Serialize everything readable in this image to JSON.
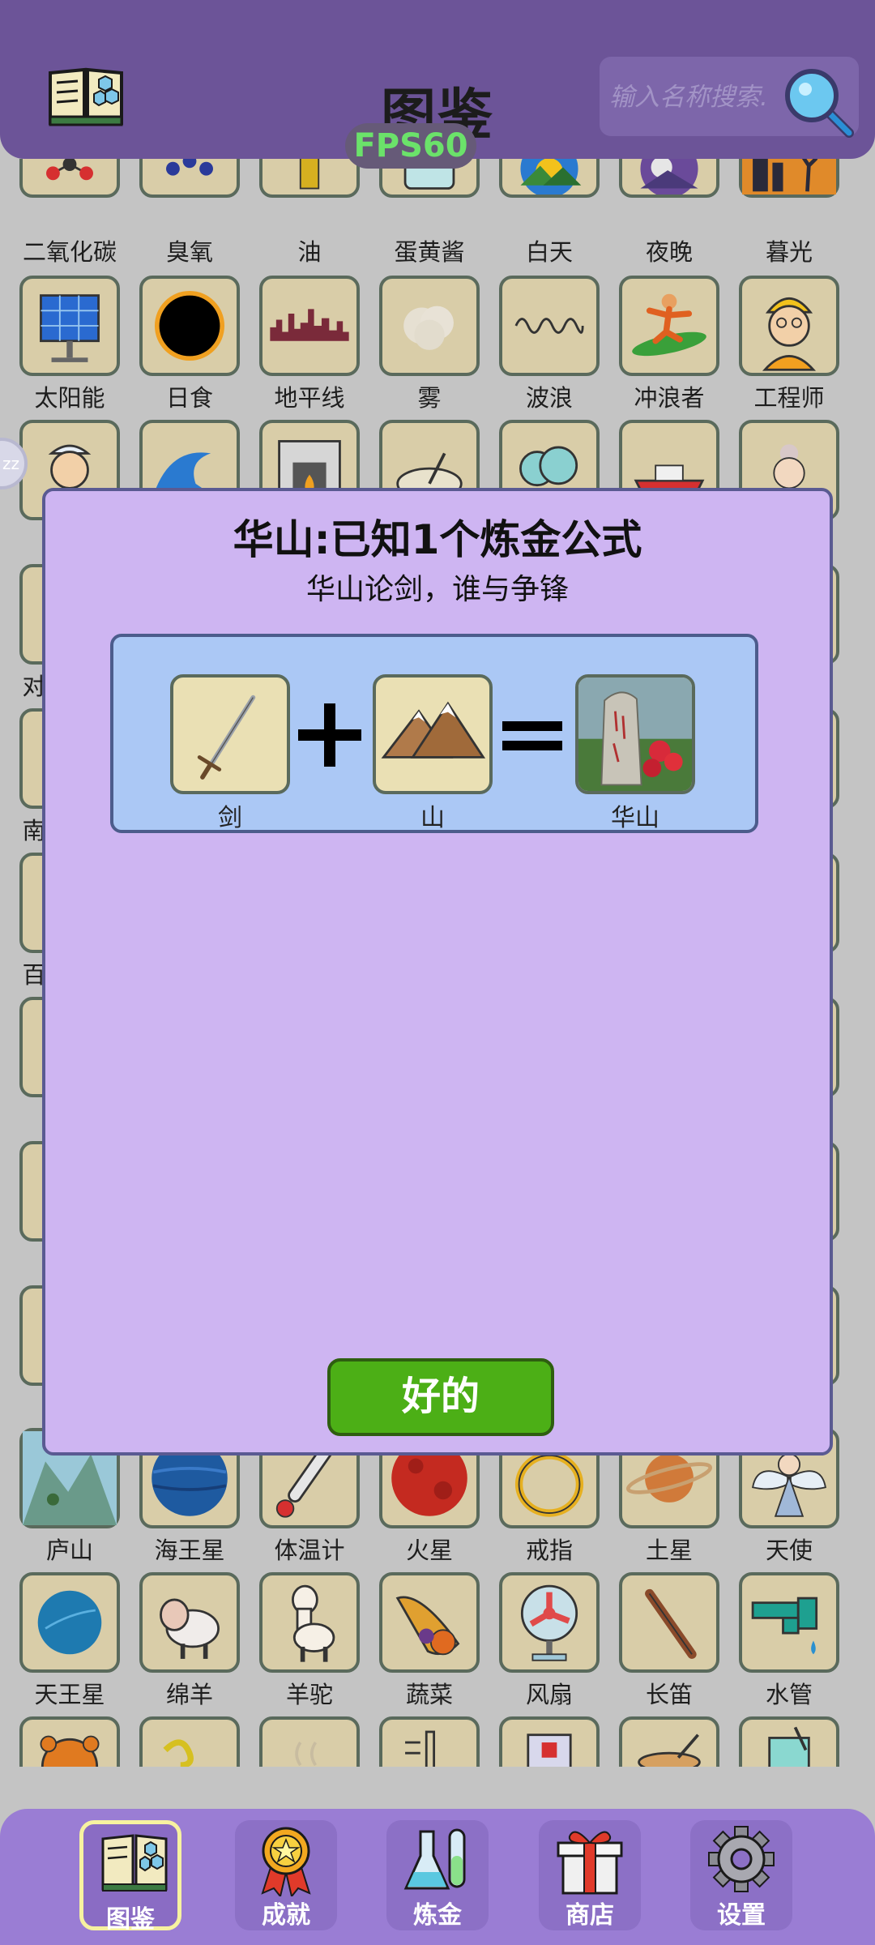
{
  "header": {
    "title": "图鉴",
    "fps": "FPS60",
    "search_placeholder": "输入名称搜索.",
    "side_badge": "zz"
  },
  "grid": {
    "row1": [
      "二氧化碳",
      "臭氧",
      "油",
      "蛋黄酱",
      "白天",
      "夜晚",
      "暮光"
    ],
    "row2": [
      "太阳能",
      "日食",
      "地平线",
      "雾",
      "波浪",
      "冲浪者",
      "工程师"
    ],
    "row_bottom1": [
      "庐山",
      "海王星",
      "体温计",
      "火星",
      "戒指",
      "土星",
      "天使"
    ],
    "row_bottom2": [
      "天王星",
      "绵羊",
      "羊驼",
      "蔬菜",
      "风扇",
      "长笛",
      "水管"
    ],
    "partial_labels": [
      "对",
      "南",
      "百"
    ]
  },
  "modal": {
    "title": "华山:已知1个炼金公式",
    "subtitle": "华山论剑，谁与争锋",
    "formula": {
      "input1": "剑",
      "input2": "山",
      "result": "华山"
    },
    "ok_label": "好的"
  },
  "nav": {
    "items": [
      {
        "label": "图鉴"
      },
      {
        "label": "成就"
      },
      {
        "label": "炼金"
      },
      {
        "label": "商店"
      },
      {
        "label": "设置"
      }
    ]
  }
}
